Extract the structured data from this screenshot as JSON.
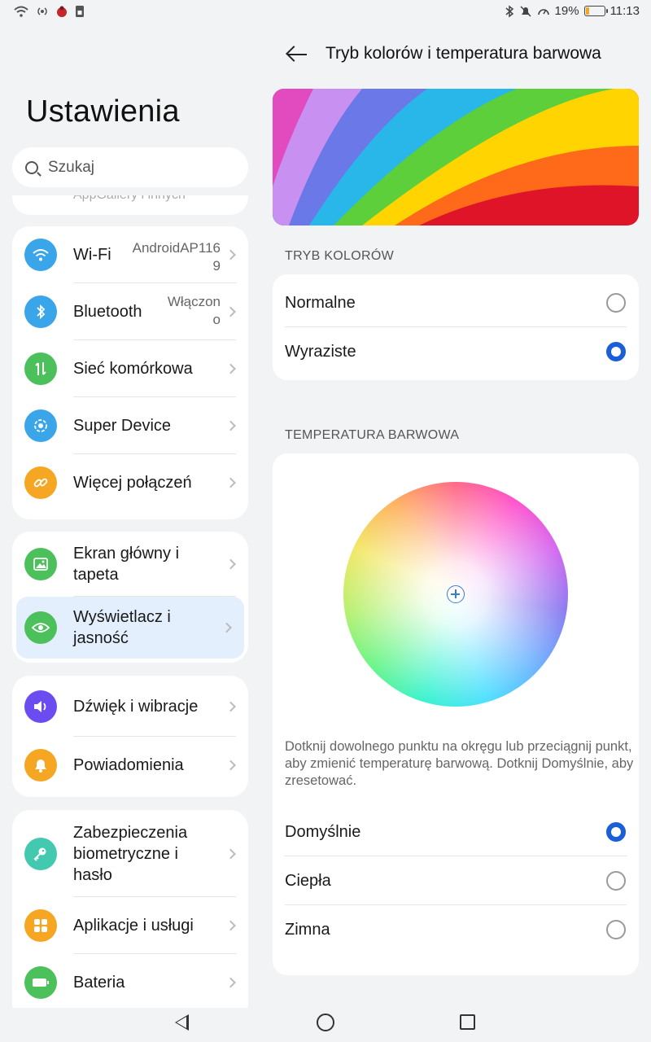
{
  "status_bar": {
    "battery_percent": "19%",
    "battery_level": 0.19,
    "time": "11:13",
    "icons_left": [
      "wifi-icon",
      "hotspot-icon",
      "bug-icon",
      "sim-icon"
    ],
    "icons_right": [
      "bluetooth-icon",
      "mute-icon",
      "speed-icon",
      "battery-icon"
    ]
  },
  "settings": {
    "title": "Ustawienia",
    "search_placeholder": "Szukaj",
    "peek_item": "AppGallery i innych",
    "groups": [
      {
        "items": [
          {
            "label": "Wi-Fi",
            "value_line1": "AndroidAP116",
            "value_line2": "9",
            "icon": "wifi-icon",
            "color": "#3aa5e8"
          },
          {
            "label": "Bluetooth",
            "value_line1": "Włączon",
            "value_line2": "o",
            "icon": "bluetooth-icon",
            "color": "#3aa5e8"
          },
          {
            "label": "Sieć komórkowa",
            "icon": "mobile-data-icon",
            "color": "#4cc05a"
          },
          {
            "label": "Super Device",
            "icon": "super-device-icon",
            "color": "#3aa5e8"
          },
          {
            "label": "Więcej połączeń",
            "icon": "link-icon",
            "color": "#f5a623"
          }
        ]
      },
      {
        "items": [
          {
            "label_line1": "Ekran główny i",
            "label_line2": "tapeta",
            "icon": "image-icon",
            "color": "#4cc05a"
          },
          {
            "label_line1": "Wyświetlacz i",
            "label_line2": "jasność",
            "icon": "eye-icon",
            "color": "#4cc05a",
            "selected": true
          }
        ]
      },
      {
        "items": [
          {
            "label": "Dźwięk i wibracje",
            "icon": "volume-icon",
            "color": "#6a4cf0"
          },
          {
            "label": "Powiadomienia",
            "icon": "bell-icon",
            "color": "#f5a623"
          }
        ]
      },
      {
        "items": [
          {
            "label_line1": "Zabezpieczenia",
            "label_line2": "biometryczne i",
            "label_line3": "hasło",
            "icon": "key-icon",
            "color": "#43c9b0"
          },
          {
            "label": "Aplikacje i usługi",
            "icon": "apps-icon",
            "color": "#f5a623"
          },
          {
            "label": "Bateria",
            "icon": "battery-icon",
            "color": "#4cc05a"
          }
        ]
      }
    ]
  },
  "detail": {
    "title": "Tryb kolorów i temperatura barwowa",
    "color_mode_header": "TRYB KOLORÓW",
    "color_modes": [
      {
        "label": "Normalne",
        "selected": false
      },
      {
        "label": "Wyraziste",
        "selected": true
      }
    ],
    "temperature_header": "TEMPERATURA BARWOWA",
    "hint": "Dotknij dowolnego punktu na okręgu lub przeciągnij punkt, aby zmienić temperaturę barwową. Dotknij Domyślnie, aby zresetować.",
    "temperatures": [
      {
        "label": "Domyślnie",
        "selected": true
      },
      {
        "label": "Ciepła",
        "selected": false
      },
      {
        "label": "Zimna",
        "selected": false
      }
    ]
  },
  "accent_color": "#1a5fd8"
}
